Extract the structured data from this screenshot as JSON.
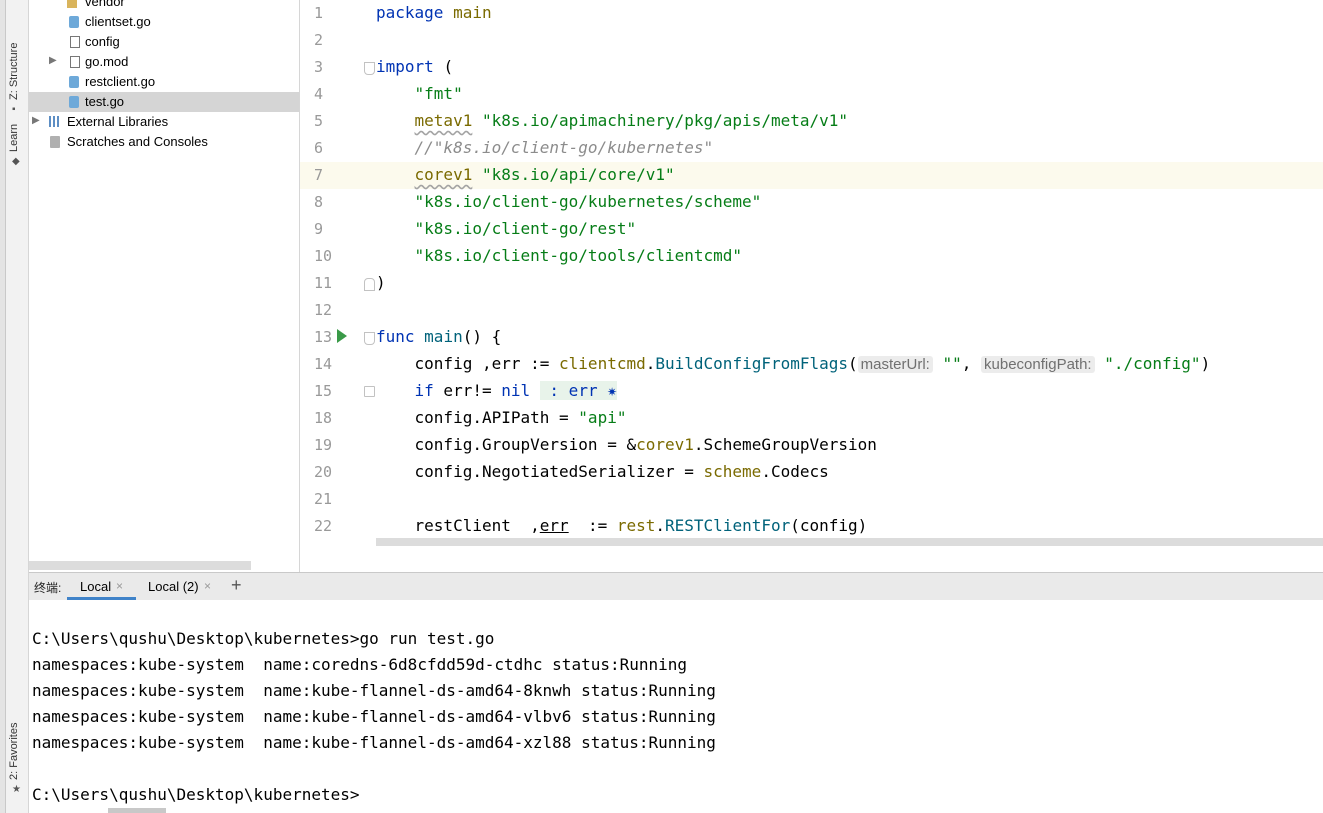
{
  "tool_windows": {
    "structure": "Z: Structure",
    "learn": "Learn",
    "favorites": "2: Favorites"
  },
  "project_tree": [
    {
      "label": "vendor",
      "type": "folder"
    },
    {
      "label": "clientset.go",
      "type": "go"
    },
    {
      "label": "config",
      "type": "file"
    },
    {
      "label": "go.mod",
      "type": "file"
    },
    {
      "label": "restclient.go",
      "type": "go"
    },
    {
      "label": "test.go",
      "type": "go",
      "selected": true
    },
    {
      "label": "External Libraries",
      "type": "library"
    },
    {
      "label": "Scratches and Consoles",
      "type": "scratch"
    }
  ],
  "editor": {
    "line_numbers": [
      "1",
      "2",
      "3",
      "4",
      "5",
      "6",
      "7",
      "8",
      "9",
      "10",
      "11",
      "12",
      "13",
      "14",
      "15",
      "18",
      "19",
      "20",
      "21",
      "22"
    ],
    "code": {
      "package_kw": "package",
      "package_name": "main",
      "import_kw": "import",
      "paren_open": "(",
      "paren_close": ")",
      "imp_fmt": "\"fmt\"",
      "alias_metav1": "metav1",
      "imp_meta": "\"k8s.io/apimachinery/pkg/apis/meta/v1\"",
      "comment_kubernetes": "//\"k8s.io/client-go/kubernetes\"",
      "alias_corev1": "corev1",
      "imp_core": "\"k8s.io/api/core/v1\"",
      "imp_scheme": "\"k8s.io/client-go/kubernetes/scheme\"",
      "imp_rest": "\"k8s.io/client-go/rest\"",
      "imp_clientcmd": "\"k8s.io/client-go/tools/clientcmd\"",
      "func_kw": "func",
      "func_name": "main",
      "func_sig": "() {",
      "l14_a": "config ,err := ",
      "l14_pkg": "clientcmd",
      "l14_dot": ".",
      "l14_fn": "BuildConfigFromFlags",
      "l14_paren": "(",
      "hint_master": "masterUrl:",
      "l14_empty": " \"\"",
      "l14_comma": ", ",
      "hint_kube": "kubeconfigPath:",
      "l14_path": " \"./config\"",
      "l14_end": ")",
      "l15_if": "if",
      "l15_mid": " err!= ",
      "l15_nil": "nil",
      "l15_fold": " : err ✷",
      "l18_a": "config.APIPath = ",
      "l18_str": "\"api\"",
      "l19_a": "config.GroupVersion = &",
      "l19_pkg": "corev1",
      "l19_b": ".SchemeGroupVersion",
      "l20_a": "config.NegotiatedSerializer = ",
      "l20_pkg": "scheme",
      "l20_b": ".Codecs",
      "l22_a": "restClient  ,",
      "l22_err": "err",
      "l22_b": "  := ",
      "l22_pkg": "rest",
      "l22_dot": ".",
      "l22_fn": "RESTClientFor",
      "l22_c": "(config)"
    }
  },
  "terminal": {
    "title": "终端:",
    "tabs": [
      {
        "label": "Local",
        "active": true
      },
      {
        "label": "Local (2)",
        "active": false
      }
    ],
    "add_label": "+",
    "close_glyph": "×",
    "lines": [
      "C:\\Users\\qushu\\Desktop\\kubernetes>go run test.go",
      "namespaces:kube-system  name:coredns-6d8cfdd59d-ctdhc status:Running",
      "namespaces:kube-system  name:kube-flannel-ds-amd64-8knwh status:Running",
      "namespaces:kube-system  name:kube-flannel-ds-amd64-vlbv6 status:Running",
      "namespaces:kube-system  name:kube-flannel-ds-amd64-xzl88 status:Running",
      "C:\\Users\\qushu\\Desktop\\kubernetes>"
    ]
  },
  "colors": {
    "keyword": "#0033b3",
    "string": "#067d17",
    "comment": "#8c8c8c",
    "package_ref": "#7a6a00",
    "function": "#00627a",
    "selection": "#d5d5d5",
    "current_line": "#fcfaed",
    "active_tab": "#4083c9",
    "run_icon": "#3a9a48"
  }
}
